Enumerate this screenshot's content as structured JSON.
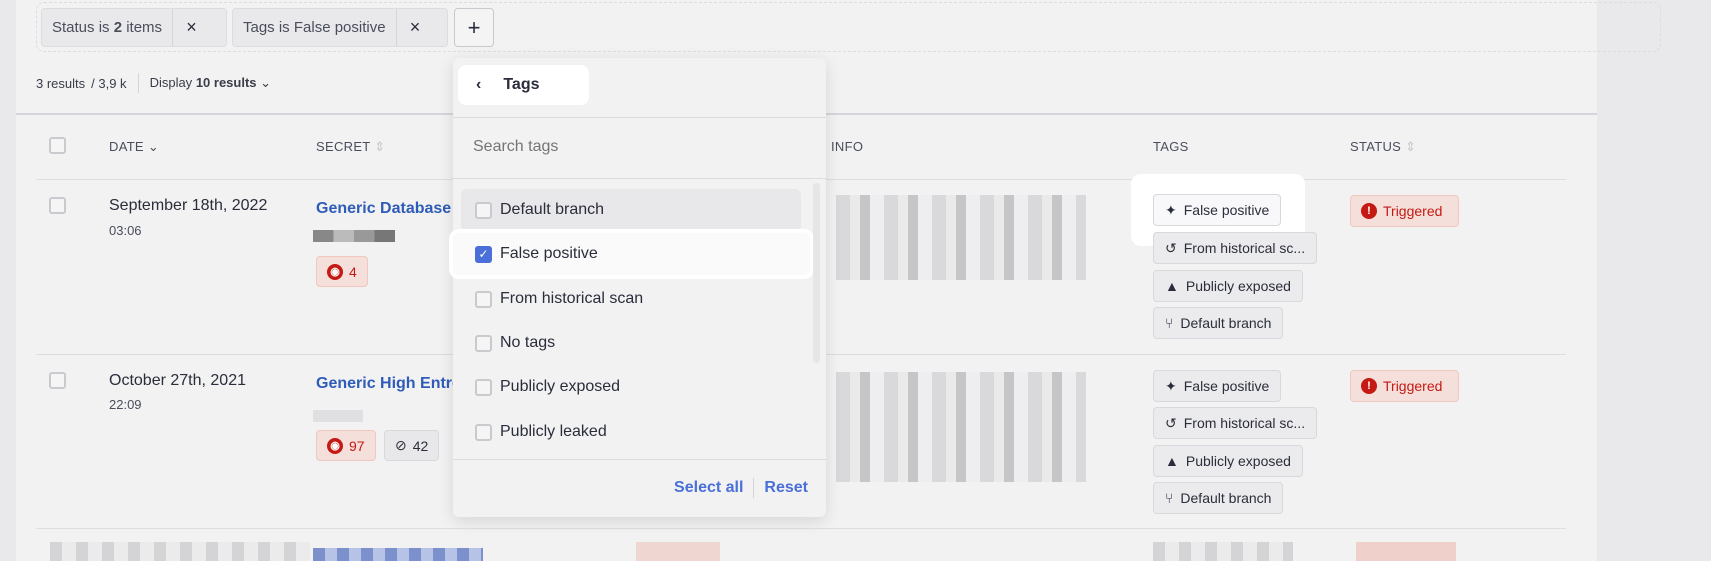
{
  "filters": [
    {
      "label_prefix": "Status is ",
      "label_bold": "2",
      "label_suffix": " items"
    },
    {
      "label_prefix": "Tags is False positive",
      "label_bold": "",
      "label_suffix": ""
    }
  ],
  "add_filter": "+",
  "results": {
    "count": "3 results",
    "total": "/ 3,9 k",
    "display_label": "Display",
    "display_value": "10 results"
  },
  "columns": {
    "date": "DATE",
    "secret": "SECRET",
    "info": "INFO",
    "tags": "TAGS",
    "status": "STATUS"
  },
  "rows": [
    {
      "date": "September 18th, 2022",
      "time": "03:06",
      "secret": "Generic Database",
      "counts": [
        {
          "value": "4",
          "type": "visible"
        }
      ],
      "tags": [
        "False positive",
        "From historical sc...",
        "Publicly exposed",
        "Default branch"
      ],
      "status": "Triggered"
    },
    {
      "date": "October 27th, 2021",
      "time": "22:09",
      "secret": "Generic High Entro",
      "counts": [
        {
          "value": "97",
          "type": "visible"
        },
        {
          "value": "42",
          "type": "hidden"
        }
      ],
      "tags": [
        "False positive",
        "From historical sc...",
        "Publicly exposed",
        "Default branch"
      ],
      "status": "Triggered"
    }
  ],
  "dropdown": {
    "title": "Tags",
    "search_placeholder": "Search tags",
    "options": [
      {
        "label": "Default branch",
        "checked": false
      },
      {
        "label": "False positive",
        "checked": true
      },
      {
        "label": "From historical scan",
        "checked": false
      },
      {
        "label": "No tags",
        "checked": false
      },
      {
        "label": "Publicly exposed",
        "checked": false
      },
      {
        "label": "Publicly leaked",
        "checked": false
      }
    ],
    "select_all": "Select all",
    "reset": "Reset"
  },
  "colors": {
    "accent": "#4a6fd8",
    "link": "#2f5cb8",
    "danger": "#c51a14",
    "danger_bg": "#f4dfda"
  }
}
